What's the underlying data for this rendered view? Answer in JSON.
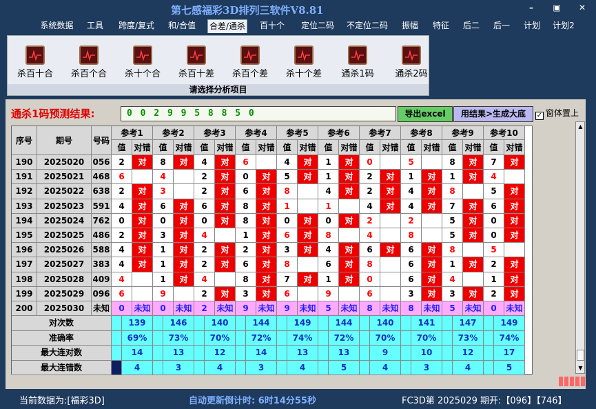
{
  "app_title": "第七感福彩3D排列三软件V8.81",
  "window_buttons": [
    "–",
    "▣",
    "✕"
  ],
  "menu": [
    "系统数据",
    "工具",
    "跨度/复式",
    "和/合值",
    "合差/通杀",
    "百十个",
    "定位二码",
    "不定位二码",
    "振幅",
    "特征",
    "后二",
    "后一",
    "计划",
    "计划2"
  ],
  "active_menu": "合差/通杀",
  "ribbon": {
    "buttons": [
      "杀百十合",
      "杀百个合",
      "杀十个合",
      "杀百十差",
      "杀百个差",
      "杀十个差",
      "通杀1码",
      "通杀2码"
    ],
    "caption": "请选择分析项目"
  },
  "prediction": {
    "label": "通杀1码预测结果:",
    "value": "0 0 2 9 9 5 8 8 5 0",
    "export": "导出excel",
    "generate": "用结果>生成大底",
    "ontop": "窗体置上"
  },
  "table": {
    "h_seq": "序号",
    "h_period": "期号",
    "h_num": "号码",
    "refs": [
      "参考1",
      "参考2",
      "参考3",
      "参考4",
      "参考5",
      "参考6",
      "参考7",
      "参考8",
      "参考9",
      "参考10"
    ],
    "sub_val": "值",
    "sub_ok": "对错",
    "ok": "对",
    "unknown": "未知",
    "rows": [
      {
        "seq": "190",
        "period": "2025020",
        "num": "056",
        "v": [
          "2",
          "8",
          "4",
          "6",
          "4",
          "1",
          "0",
          "5",
          "8",
          "7"
        ],
        "ok": [
          1,
          1,
          1,
          0,
          1,
          1,
          0,
          0,
          1,
          1
        ],
        "red": [
          0,
          0,
          0,
          1,
          0,
          0,
          1,
          1,
          0,
          0
        ]
      },
      {
        "seq": "191",
        "period": "2025021",
        "num": "468",
        "v": [
          "6",
          "4",
          "2",
          "0",
          "5",
          "1",
          "2",
          "1",
          "1",
          "4"
        ],
        "ok": [
          0,
          0,
          1,
          1,
          1,
          1,
          1,
          1,
          1,
          0
        ],
        "red": [
          1,
          1,
          0,
          0,
          0,
          0,
          0,
          0,
          0,
          1
        ]
      },
      {
        "seq": "192",
        "period": "2025022",
        "num": "638",
        "v": [
          "2",
          "3",
          "2",
          "6",
          "8",
          "4",
          "2",
          "4",
          "8",
          "5"
        ],
        "ok": [
          1,
          0,
          1,
          1,
          0,
          1,
          1,
          1,
          0,
          1
        ],
        "red": [
          0,
          1,
          0,
          0,
          1,
          0,
          0,
          0,
          1,
          0
        ]
      },
      {
        "seq": "193",
        "period": "2025023",
        "num": "591",
        "v": [
          "4",
          "6",
          "6",
          "8",
          "1",
          "1",
          "4",
          "4",
          "7",
          "6"
        ],
        "ok": [
          1,
          1,
          1,
          1,
          0,
          0,
          1,
          1,
          1,
          1
        ],
        "red": [
          0,
          0,
          0,
          0,
          1,
          1,
          0,
          0,
          0,
          0
        ]
      },
      {
        "seq": "194",
        "period": "2025024",
        "num": "762",
        "v": [
          "0",
          "0",
          "0",
          "8",
          "0",
          "0",
          "2",
          "2",
          "5",
          "0"
        ],
        "ok": [
          1,
          1,
          1,
          1,
          1,
          1,
          0,
          0,
          1,
          1
        ],
        "red": [
          0,
          0,
          0,
          0,
          0,
          0,
          1,
          1,
          0,
          0
        ]
      },
      {
        "seq": "195",
        "period": "2025025",
        "num": "486",
        "v": [
          "2",
          "3",
          "4",
          "1",
          "6",
          "8",
          "4",
          "8",
          "5",
          "0"
        ],
        "ok": [
          1,
          1,
          0,
          1,
          1,
          0,
          0,
          0,
          1,
          1
        ],
        "red": [
          0,
          0,
          1,
          0,
          1,
          1,
          1,
          1,
          0,
          0
        ]
      },
      {
        "seq": "196",
        "period": "2025026",
        "num": "588",
        "v": [
          "4",
          "1",
          "2",
          "2",
          "3",
          "4",
          "6",
          "6",
          "8",
          "5"
        ],
        "ok": [
          1,
          1,
          1,
          1,
          1,
          1,
          1,
          1,
          0,
          0
        ],
        "red": [
          0,
          0,
          0,
          0,
          0,
          0,
          0,
          0,
          1,
          1
        ]
      },
      {
        "seq": "197",
        "period": "2025027",
        "num": "383",
        "v": [
          "4",
          "1",
          "2",
          "6",
          "8",
          "6",
          "8",
          "6",
          "1",
          "2"
        ],
        "ok": [
          1,
          1,
          1,
          1,
          0,
          1,
          0,
          1,
          1,
          1
        ],
        "red": [
          0,
          0,
          0,
          0,
          1,
          0,
          1,
          0,
          0,
          0
        ]
      },
      {
        "seq": "198",
        "period": "2025028",
        "num": "409",
        "v": [
          "4",
          "1",
          "4",
          "8",
          "7",
          "1",
          "0",
          "6",
          "4",
          "1"
        ],
        "ok": [
          0,
          1,
          0,
          1,
          1,
          1,
          0,
          1,
          0,
          1
        ],
        "red": [
          1,
          0,
          1,
          0,
          0,
          0,
          1,
          0,
          1,
          0
        ]
      },
      {
        "seq": "199",
        "period": "2025029",
        "num": "096",
        "v": [
          "6",
          "9",
          "2",
          "3",
          "6",
          "9",
          "6",
          "3",
          "3",
          "2"
        ],
        "ok": [
          0,
          0,
          1,
          1,
          0,
          0,
          0,
          1,
          1,
          1
        ],
        "red": [
          1,
          1,
          0,
          0,
          1,
          1,
          1,
          0,
          0,
          0
        ]
      },
      {
        "seq": "200",
        "period": "2025030",
        "num": "未知",
        "v": [
          "0",
          "0",
          "2",
          "9",
          "9",
          "5",
          "8",
          "8",
          "5",
          "0"
        ]
      }
    ],
    "summary": [
      {
        "label": "对次数",
        "values": [
          "139",
          "146",
          "140",
          "144",
          "149",
          "144",
          "140",
          "141",
          "147",
          "149"
        ]
      },
      {
        "label": "准确率",
        "values": [
          "69%",
          "73%",
          "70%",
          "72%",
          "74%",
          "72%",
          "70%",
          "70%",
          "73%",
          "74%"
        ]
      },
      {
        "label": "最大连对数",
        "values": [
          "14",
          "13",
          "12",
          "14",
          "13",
          "13",
          "9",
          "10",
          "12",
          "17"
        ]
      },
      {
        "label": "最大连错数",
        "values": [
          "4",
          "3",
          "4",
          "3",
          "4",
          "5",
          "4",
          "3",
          "4",
          "5"
        ]
      }
    ]
  },
  "status": {
    "current": "当前数据为:[福彩3D]",
    "countdown": "自动更新倒计时: 6时14分55秒",
    "issue": "FC3D第 2025029 期开:【096】【746】"
  }
}
